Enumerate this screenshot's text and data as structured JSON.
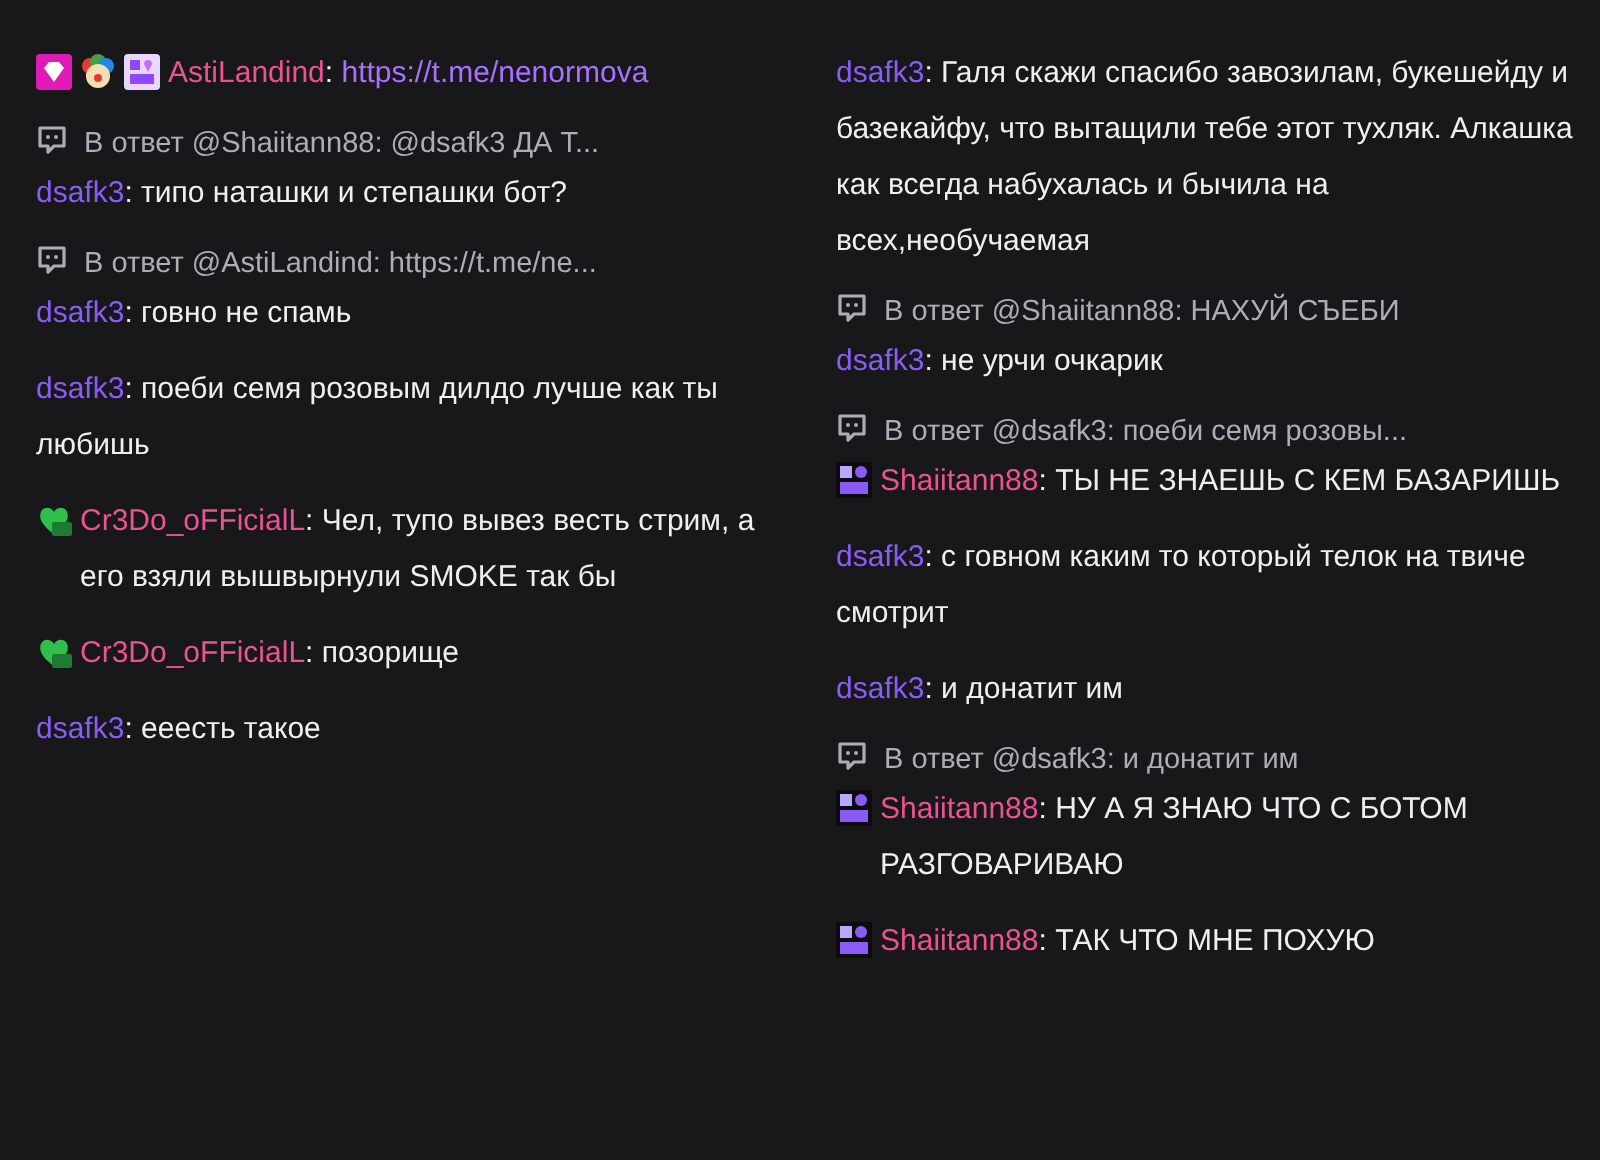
{
  "columns": [
    {
      "messages": [
        {
          "badges": [
            {
              "kind": "gem"
            },
            {
              "kind": "clown"
            },
            {
              "kind": "calendar-purple"
            }
          ],
          "user": "AstiLandind",
          "colon": ":",
          "color": "#eb5294",
          "text": "https://t.me/nenormova",
          "link": true
        },
        {
          "reply": "В ответ @Shaiitann88: @dsafk3 ДА Т...",
          "user": "dsafk3",
          "colon": ":",
          "color": "#8a5cf5",
          "text": "типо наташки и степашки бот?",
          "link": false
        },
        {
          "reply": "В ответ @AstiLandind: https://t.me/ne...",
          "user": "dsafk3",
          "colon": ":",
          "color": "#8a5cf5",
          "text": "говно не спамь",
          "link": false
        },
        {
          "user": "dsafk3",
          "colon": ":",
          "color": "#8a5cf5",
          "text": "поеби семя розовым дилдо лучше как ты любишь",
          "link": false
        },
        {
          "badges": [
            {
              "kind": "heart-green"
            }
          ],
          "user": "Cr3Do_oFFicialL",
          "colon": ":",
          "color": "#eb5294",
          "text": "Чел, тупо вывез весть стрим, а его взяли вышвырнули SMOKE так бы",
          "link": false
        },
        {
          "badges": [
            {
              "kind": "heart-green"
            }
          ],
          "user": "Cr3Do_oFFicialL",
          "colon": ":",
          "color": "#eb5294",
          "text": "позорище",
          "link": false
        },
        {
          "user": "dsafk3",
          "colon": ":",
          "color": "#8a5cf5",
          "text": "ееесть такое",
          "link": false
        }
      ]
    },
    {
      "messages": [
        {
          "user": "dsafk3",
          "colon": ":",
          "color": "#8a5cf5",
          "text": "Галя скажи спасибо завозилам, букешейду и базекайфу, что вытащили тебе этот тухляк. Алкашка как всегда набухалась и бычила на всех,необучаемая",
          "link": false
        },
        {
          "reply": "В ответ @Shaiitann88: НАХУЙ СЪЕБИ",
          "user": "dsafk3",
          "colon": ":",
          "color": "#8a5cf5",
          "text": "не урчи очкарик",
          "link": false
        },
        {
          "reply": "В ответ @dsafk3: поеби семя розовы...",
          "badges": [
            {
              "kind": "calendar-dark"
            }
          ],
          "user": "Shaiitann88",
          "colon": ":",
          "color": "#eb5294",
          "text": "ТЫ НЕ ЗНАЕШЬ С КЕМ БАЗАРИШЬ",
          "link": false
        },
        {
          "user": "dsafk3",
          "colon": ":",
          "color": "#8a5cf5",
          "text": "с говном каким то который телок на твиче смотрит",
          "link": false
        },
        {
          "user": "dsafk3",
          "colon": ":",
          "color": "#8a5cf5",
          "text": "и донатит им",
          "link": false
        },
        {
          "reply": "В ответ @dsafk3: и донатит им",
          "badges": [
            {
              "kind": "calendar-dark"
            }
          ],
          "user": "Shaiitann88",
          "colon": ":",
          "color": "#eb5294",
          "text": "НУ А Я ЗНАЮ ЧТО С БОТОМ РАЗГОВАРИВАЮ",
          "link": false
        },
        {
          "badges": [
            {
              "kind": "calendar-dark"
            }
          ],
          "user": "Shaiitann88",
          "colon": ":",
          "color": "#eb5294",
          "text": "ТАК ЧТО МНЕ ПОХУЮ",
          "link": false
        }
      ]
    }
  ]
}
